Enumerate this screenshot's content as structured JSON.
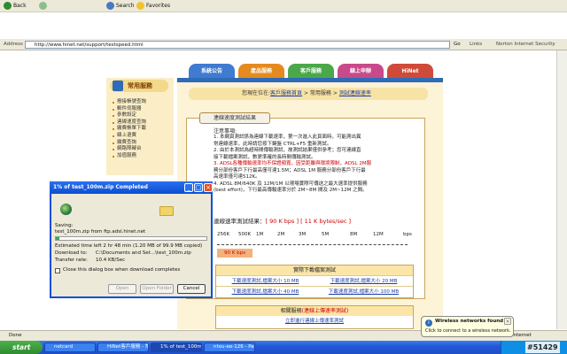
{
  "browser": {
    "toolbar": {
      "back": "Back",
      "search": "Search",
      "favorites": "Favorites"
    },
    "address": {
      "label": "Address",
      "url": "http://www.hinet.net/support/testspeed.html",
      "go": "Go",
      "links": "Links",
      "norton": "Norton Internet Security"
    }
  },
  "site": {
    "tabs": [
      "系統公告",
      "產品服務",
      "客戶服務",
      "線上申辦",
      "HiNet"
    ],
    "tab_colors": [
      "#3f7bd0",
      "#e58a1e",
      "#4aa84a",
      "#c84a8a",
      "#d04a3a"
    ],
    "breadcrumb": {
      "prefix": "您現在位在:",
      "home": "客戶服務首頁",
      "sep1": ">",
      "middle": "常用服務",
      "sep2": ">",
      "current": "測試連線速率"
    },
    "sidebar": {
      "title": "常用服務",
      "items": [
        "撥接帳號查詢",
        "郵件伺服器",
        "參數設定",
        "連線速度查詢",
        "繳費帳單下載",
        "線上退費",
        "繳費查詢",
        "網路障礙台",
        "加值服務"
      ]
    },
    "speedtest": {
      "box_title": "連線速度測試結果",
      "notes_title": "注意事項:",
      "notes": [
        "1. 本網頁測試係為連線下載速率，第一次進入此頁面時，可能測出異",
        "常連線速率，此時請您按下鍵盤 CTRL+F5 重新測試。",
        "2. 由於本測試為超時間傳輸測試，故測試結果僅供參考；您可連線直",
        "接下載檔案測試，數更準確的長時間傳輸測試。",
        "3. ADSL各種傳輸速率均不保證頻寬，因受距離與環境限制，ADSL 2M服",
        "務分部份客戶下行最高僅可達1.5M；ADSL 1M 服務分部份客戶下行最",
        "高速率僅可達512K。",
        "4. ADSL 8M/640K 及 12M/1M 以現場實際可傳送之最大速率提供服務",
        "(best effort)，下行最高傳輸速率分於 2M~8M 間及 2M~12M 之間。"
      ],
      "result_label": "連線速率測試結果：",
      "result_value": "[ 90 K bps ] [ 11 K bytes/sec ]",
      "scale": [
        "256K",
        "500K",
        "1M",
        "2M",
        "3M",
        "5M",
        "8M",
        "12M",
        "bps"
      ],
      "bar_label": "90 K bps",
      "download_title": "實際下載檔案測試",
      "downloads": [
        [
          "下載速度測試,檔案大小 10 MB",
          "下載速度測試,檔案大小 20 MB"
        ],
        [
          "下載速度測試,檔案大小 40 MB",
          "下載速度測試,檔案大小 100 MB"
        ]
      ],
      "related_title": "相關服務",
      "related_highlight": "(連線上傳速率測試)",
      "related_link": "立即進行連線上傳速率測試"
    },
    "progress": {
      "measured_kbps": 90
    }
  },
  "dialog": {
    "title": "1% of test_100m.zip Completed",
    "saving_label": "Saving:",
    "saving_value": "test_100m.zip from ftp.adsl.hinet.net",
    "progress_percent": 1,
    "estimated_label": "Estimated time left",
    "estimated_value": "2 hr 48 min (1.20 MB of 99.9 MB copied)",
    "download_to_label": "Download to:",
    "download_to_value": "C:\\Documents and Set...\\test_100m.zip",
    "rate_label": "Transfer rate:",
    "rate_value": "10.4 KB/Sec",
    "close_checkbox": "Close this dialog box when download completes",
    "open_btn": "Open",
    "open_folder_btn": "Open Folder",
    "cancel_btn": "Cancel"
  },
  "status": {
    "done": "Done",
    "zone": "Internet"
  },
  "balloon": {
    "title": "Wireless networks found",
    "body": "Click to connect to a wireless network."
  },
  "taskbar": {
    "start": "start",
    "tasks": [
      "netcard",
      "HiNet客戶服務 - 常...",
      "1% of test_100m.zip...",
      "ntou-ee-126 - Paint"
    ],
    "watermark": "#51429"
  }
}
